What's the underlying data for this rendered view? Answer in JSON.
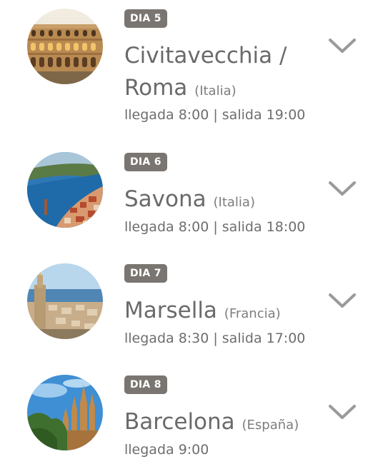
{
  "itinerary": [
    {
      "badge": "DIA 5",
      "port_line1": "Civitavecchia /",
      "port_line2": "Roma",
      "country": "(Italia)",
      "arrival": "llegada 8:00",
      "separator": "|",
      "departure": "salida 19:00",
      "image": "colosseum-photo"
    },
    {
      "badge": "DIA 6",
      "port": "Savona",
      "country": "(Italia)",
      "arrival": "llegada 8:00",
      "separator": "|",
      "departure": "salida 18:00",
      "image": "coastal-town-photo"
    },
    {
      "badge": "DIA 7",
      "port": "Marsella",
      "country": "(Francia)",
      "arrival": "llegada 8:30",
      "separator": "|",
      "departure": "salida 17:00",
      "image": "marseille-city-photo"
    },
    {
      "badge": "DIA 8",
      "port": "Barcelona",
      "country": "(España)",
      "arrival": "llegada 9:00",
      "image": "sagrada-familia-photo"
    }
  ],
  "icons": {
    "expand": "chevron-down-icon"
  },
  "colors": {
    "badge_bg": "#7a7570",
    "text": "#6a6a6a",
    "chevron": "#9a9a9a"
  }
}
